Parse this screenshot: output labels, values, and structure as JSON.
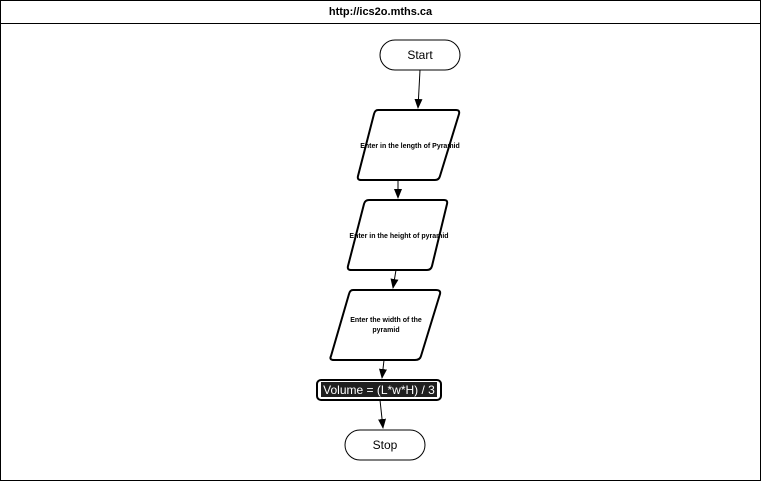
{
  "header": {
    "url": "http://ics2o.mths.ca"
  },
  "flowchart": {
    "start_label": "Start",
    "input_length": "Enter in the length of Pyramid",
    "input_height": "Enter in the height of pyramid",
    "input_width_line1": "Enter the width of the",
    "input_width_line2": "pyramid",
    "process_volume": "Volume = (L*w*H) / 3",
    "stop_label": "Stop"
  }
}
